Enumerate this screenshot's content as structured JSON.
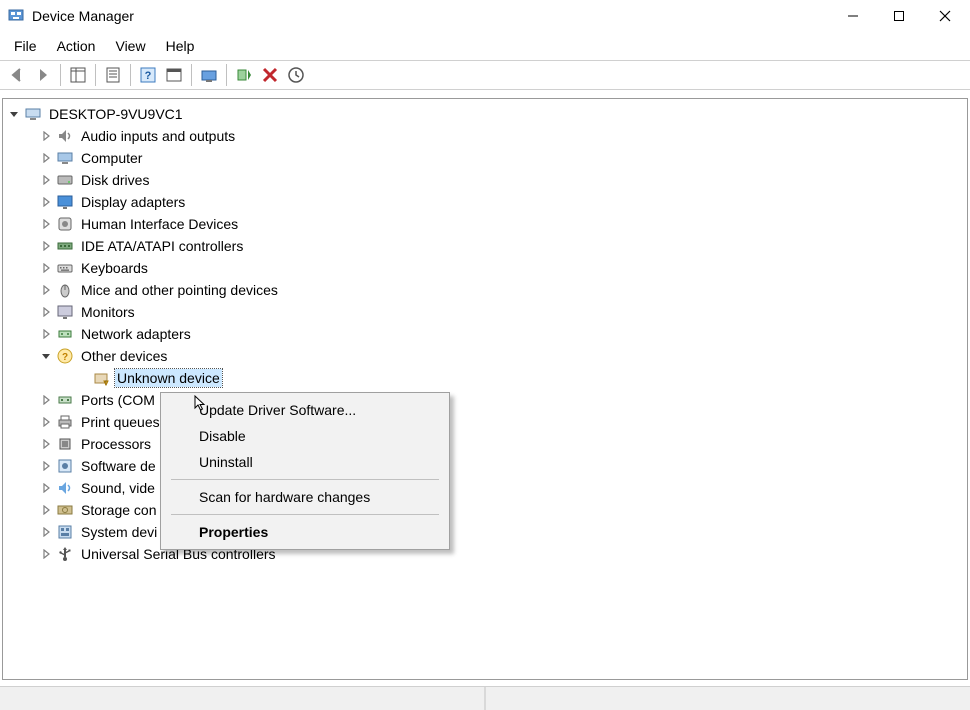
{
  "window": {
    "title": "Device Manager"
  },
  "menu": {
    "file": "File",
    "action": "Action",
    "view": "View",
    "help": "Help"
  },
  "tree": {
    "root": "DESKTOP-9VU9VC1",
    "categories": [
      {
        "label": "Audio inputs and outputs",
        "icon": "audio"
      },
      {
        "label": "Computer",
        "icon": "computer"
      },
      {
        "label": "Disk drives",
        "icon": "disk"
      },
      {
        "label": "Display adapters",
        "icon": "display"
      },
      {
        "label": "Human Interface Devices",
        "icon": "hid"
      },
      {
        "label": "IDE ATA/ATAPI controllers",
        "icon": "ide"
      },
      {
        "label": "Keyboards",
        "icon": "keyboard"
      },
      {
        "label": "Mice and other pointing devices",
        "icon": "mouse"
      },
      {
        "label": "Monitors",
        "icon": "monitor"
      },
      {
        "label": "Network adapters",
        "icon": "network"
      },
      {
        "label": "Other devices",
        "icon": "other",
        "expanded": true,
        "children": [
          {
            "label": "Unknown device",
            "icon": "unknown",
            "selected": true
          }
        ]
      },
      {
        "label": "Ports (COM",
        "icon": "port",
        "truncated_by_menu": true,
        "full_label": "Ports (COM & LPT)"
      },
      {
        "label": "Print queues",
        "icon": "printer",
        "truncated_by_menu": true,
        "full_label": "Print queues"
      },
      {
        "label": "Processors",
        "icon": "cpu"
      },
      {
        "label": "Software de",
        "icon": "software",
        "truncated_by_menu": true,
        "full_label": "Software devices"
      },
      {
        "label": "Sound, vide",
        "icon": "sound",
        "truncated_by_menu": true,
        "full_label": "Sound, video and game controllers"
      },
      {
        "label": "Storage con",
        "icon": "storage",
        "truncated_by_menu": true,
        "full_label": "Storage controllers"
      },
      {
        "label": "System devi",
        "icon": "system",
        "truncated_by_menu": true,
        "full_label": "System devices"
      },
      {
        "label": "Universal Serial Bus controllers",
        "icon": "usb"
      }
    ]
  },
  "context_menu": {
    "items": [
      {
        "label": "Update Driver Software...",
        "key": "update"
      },
      {
        "label": "Disable",
        "key": "disable"
      },
      {
        "label": "Uninstall",
        "key": "uninstall"
      },
      {
        "sep": true
      },
      {
        "label": "Scan for hardware changes",
        "key": "scan"
      },
      {
        "sep": true
      },
      {
        "label": "Properties",
        "key": "properties",
        "bold": true
      }
    ]
  }
}
